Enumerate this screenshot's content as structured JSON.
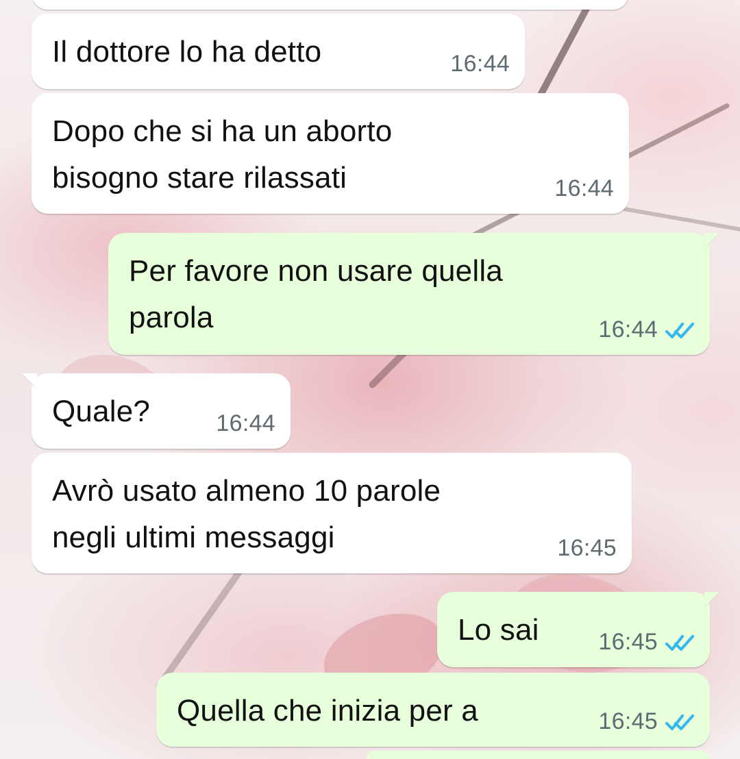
{
  "theme": {
    "incoming_bubble": "#ffffff",
    "outgoing_bubble": "#e7ffdb",
    "read_check_color": "#34b7f1",
    "timestamp_color": "#5f6b70"
  },
  "messages": [
    {
      "id": "m1",
      "direction": "incoming",
      "text": "Il dottore lo ha detto",
      "time": "16:44"
    },
    {
      "id": "m2",
      "direction": "incoming",
      "text": "Dopo che si ha un aborto\nbisogno stare rilassati",
      "time": "16:44"
    },
    {
      "id": "m3",
      "direction": "outgoing",
      "text": "Per favore non usare quella\nparola",
      "time": "16:44",
      "status_icon": "double-check-icon"
    },
    {
      "id": "m4",
      "direction": "incoming",
      "text": "Quale?",
      "time": "16:44"
    },
    {
      "id": "m5",
      "direction": "incoming",
      "text": "Avrò usato almeno 10 parole\nnegli ultimi messaggi",
      "time": "16:45"
    },
    {
      "id": "m6",
      "direction": "outgoing",
      "text": "Lo sai",
      "time": "16:45",
      "status_icon": "double-check-icon"
    },
    {
      "id": "m7",
      "direction": "outgoing",
      "text": "Quella che inizia per a",
      "time": "16:45",
      "status_icon": "double-check-icon"
    }
  ]
}
